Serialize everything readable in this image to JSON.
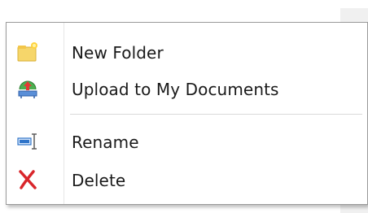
{
  "context_menu": {
    "items": [
      {
        "label": "New Folder",
        "icon": "new-folder-icon"
      },
      {
        "label": "Upload to My Documents",
        "icon": "upload-icon"
      },
      {
        "label": "Rename",
        "icon": "rename-icon"
      },
      {
        "label": "Delete",
        "icon": "delete-icon"
      }
    ],
    "colors": {
      "folder": "#f5c84a",
      "delete": "#d9262b",
      "rename_accent": "#2f74c9",
      "upload_green": "#3aa24a"
    }
  }
}
